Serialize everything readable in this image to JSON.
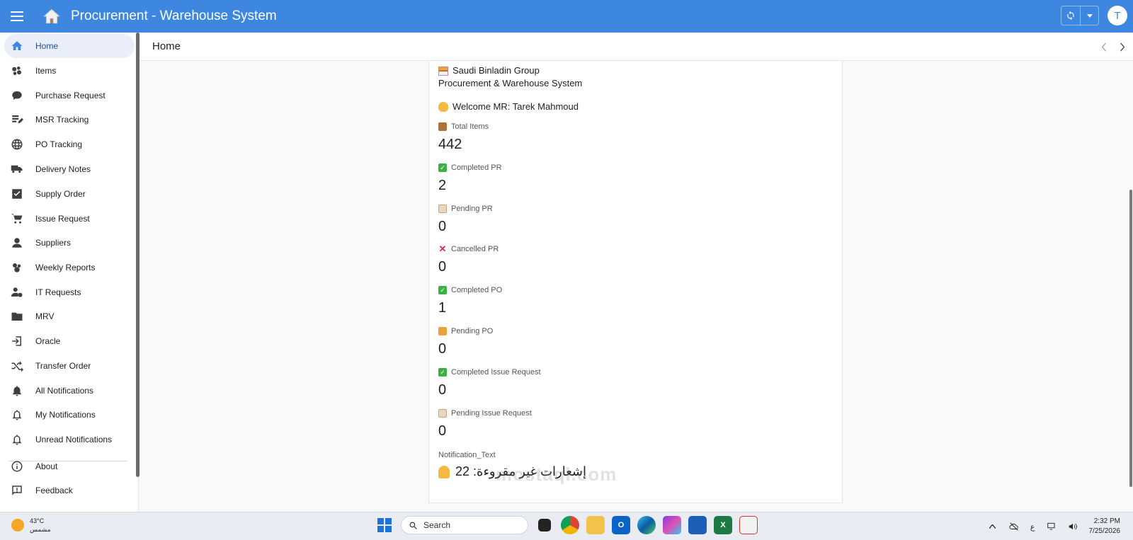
{
  "app": {
    "title": "Procurement - Warehouse System",
    "avatar_letter": "T",
    "accent": "#3d87e0"
  },
  "sidebar": {
    "items": [
      {
        "label": "Home",
        "icon": "home-icon",
        "active": true
      },
      {
        "label": "Items",
        "icon": "items-icon"
      },
      {
        "label": "Purchase Request",
        "icon": "chat-icon"
      },
      {
        "label": "MSR Tracking",
        "icon": "edit-document-icon"
      },
      {
        "label": "PO Tracking",
        "icon": "globe-icon"
      },
      {
        "label": "Delivery Notes",
        "icon": "truck-icon"
      },
      {
        "label": "Supply Order",
        "icon": "checkbox-icon"
      },
      {
        "label": "Issue Request",
        "icon": "cart-icon"
      },
      {
        "label": "Suppliers",
        "icon": "supplier-icon"
      },
      {
        "label": "Weekly Reports",
        "icon": "reports-icon"
      },
      {
        "label": "IT Requests",
        "icon": "user-gear-icon"
      },
      {
        "label": "MRV",
        "icon": "folder-icon"
      },
      {
        "label": "Oracle",
        "icon": "sign-in-icon"
      },
      {
        "label": "Transfer Order",
        "icon": "shuffle-icon"
      },
      {
        "label": "All Notifications",
        "icon": "bell-filled-icon"
      },
      {
        "label": "My Notifications",
        "icon": "bell-outline-icon"
      },
      {
        "label": "Unread Notifications",
        "icon": "bell-outline-icon"
      },
      {
        "label": "About",
        "icon": "info-icon"
      },
      {
        "label": "Feedback",
        "icon": "feedback-icon"
      }
    ]
  },
  "page": {
    "title": "Home"
  },
  "home": {
    "org_line1": "Saudi Binladin Group",
    "org_line2": "Procurement & Warehouse System",
    "welcome": "Welcome MR: Tarek Mahmoud",
    "stats": [
      {
        "label": "Total Items",
        "value": "442",
        "icon": "package-icon",
        "color": "#b0703a"
      },
      {
        "label": "Completed PR",
        "value": "2",
        "icon": "check-box-icon",
        "color": "#3cb043"
      },
      {
        "label": "Pending PR",
        "value": "0",
        "icon": "clipboard-icon",
        "color": "#c9a27a"
      },
      {
        "label": "Cancelled PR",
        "value": "0",
        "icon": "cross-icon",
        "color": "#e0245e"
      },
      {
        "label": "Completed PO",
        "value": "1",
        "icon": "check-box-icon",
        "color": "#3cb043"
      },
      {
        "label": "Pending PO",
        "value": "0",
        "icon": "truck-emoji-icon",
        "color": "#e8a33c"
      },
      {
        "label": "Completed Issue Request",
        "value": "0",
        "icon": "check-box-icon",
        "color": "#3cb043"
      },
      {
        "label": "Pending Issue Request",
        "value": "0",
        "icon": "clipboard-icon",
        "color": "#c9a27a"
      }
    ],
    "notification_label": "Notification_Text",
    "notification_text": "إشعارات غير مقروءة: 22"
  },
  "taskbar": {
    "temperature": "43°C",
    "weather_desc": "مشمس",
    "search_placeholder": "Search",
    "input_indicator": "ع",
    "time": "2:32 PM",
    "date": "7/25/2026"
  },
  "watermark": "mostaql.com"
}
